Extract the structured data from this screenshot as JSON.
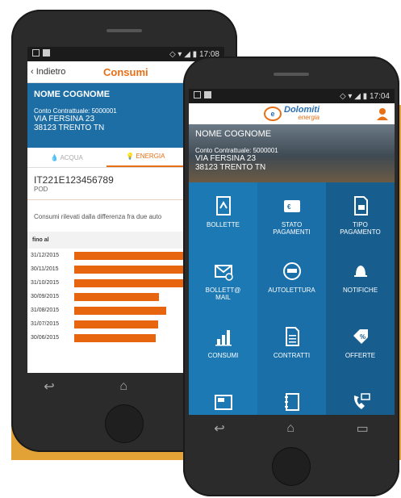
{
  "back_phone": {
    "status_time": "17:08",
    "back_label": "Indietro",
    "title": "Consumi",
    "user_name": "NOME COGNOME",
    "contract": "Conto Contrattuale: 5000001",
    "address1": "VIA FERSINA 23",
    "address2": "38123 TRENTO TN",
    "tabs": [
      {
        "label": "ACQUA"
      },
      {
        "label": "ENERGIA"
      }
    ],
    "pod_code": "IT221E123456789",
    "pod_label": "POD",
    "note": "Consumi rilevati dalla differenza fra due auto",
    "table_header": "fino al",
    "rows": [
      {
        "date": "31/12/2015",
        "value": 100
      },
      {
        "date": "30/11/2015",
        "value": 100
      },
      {
        "date": "31/10/2015",
        "value": 100
      },
      {
        "date": "30/09/2015",
        "value": 71
      },
      {
        "date": "31/08/2015",
        "value": 77
      },
      {
        "date": "31/07/2015",
        "value": 70
      },
      {
        "date": "30/06/2015",
        "value": 68
      }
    ]
  },
  "front_phone": {
    "status_time": "17:04",
    "logo_main": "Dolomiti",
    "logo_sub": "energia",
    "user_name": "NOME COGNOME",
    "contract": "Conto Contrattuale: 5000001",
    "address1": "VIA FERSINA 23",
    "address2": "38123 TRENTO TN",
    "tiles": [
      {
        "label": "BOLLETTE",
        "icon": "pdf-bill-icon"
      },
      {
        "label": "STATO\nPAGAMENTI",
        "icon": "wallet-icon"
      },
      {
        "label": "TIPO\nPAGAMENTO",
        "icon": "payment-doc-icon"
      },
      {
        "label": "BOLLETT@\nMAIL",
        "icon": "mail-at-icon"
      },
      {
        "label": "AUTOLETTURA",
        "icon": "meter-icon"
      },
      {
        "label": "NOTIFICHE",
        "icon": "bell-icon"
      },
      {
        "label": "CONSUMI",
        "icon": "bar-chart-icon"
      },
      {
        "label": "CONTRATTI",
        "icon": "document-icon"
      },
      {
        "label": "OFFERTE",
        "icon": "percent-tag-icon"
      },
      {
        "label": "",
        "icon": "news-icon"
      },
      {
        "label": "",
        "icon": "notebook-icon"
      },
      {
        "label": "",
        "icon": "phone-mail-icon"
      }
    ]
  },
  "colors": {
    "orange": "#e76f16",
    "blue": "#1c79b4",
    "accent_bg": "#e2a236"
  }
}
